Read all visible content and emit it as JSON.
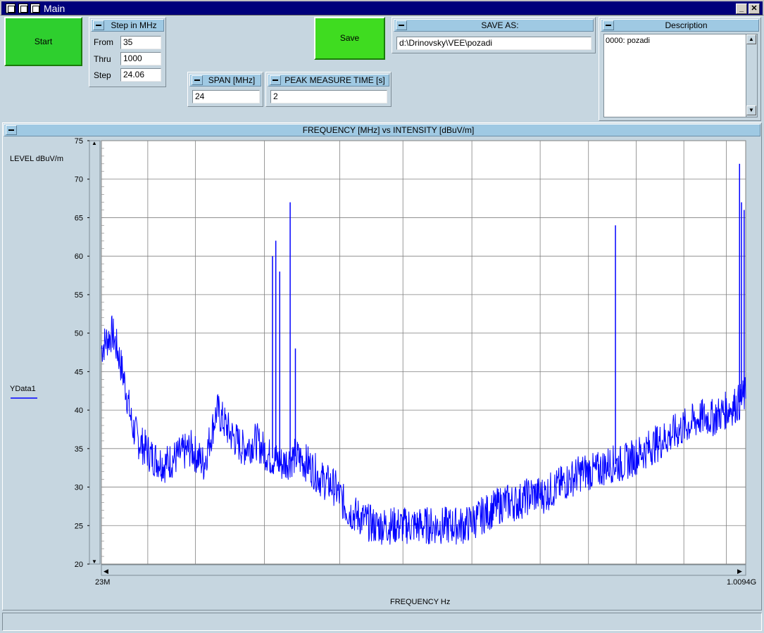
{
  "window": {
    "title": "Main"
  },
  "buttons": {
    "start": "Start",
    "save": "Save"
  },
  "step_panel": {
    "title": "Step in MHz",
    "from_label": "From",
    "from_value": "35",
    "thru_label": "Thru",
    "thru_value": "1000",
    "step_label": "Step",
    "step_value": "24.06"
  },
  "span_panel": {
    "title": "SPAN [MHz]",
    "value": "24"
  },
  "peak_panel": {
    "title": "PEAK MEASURE TIME [s]",
    "value": "2"
  },
  "save_panel": {
    "title": "SAVE AS:",
    "value": "d:\\Drinovsky\\VEE\\pozadi"
  },
  "description_panel": {
    "title": "Description",
    "value": "0000: pozadi"
  },
  "chart_panel": {
    "title": "FREQUENCY [MHz] vs INTENSITY [dBuV/m]"
  },
  "colors": {
    "trace": "#0000ff",
    "start_button": "#2ecf2e",
    "save_button": "#3fdc20",
    "panel_header": "#9fc9e3"
  },
  "chart_data": {
    "type": "line",
    "title": "FREQUENCY [MHz] vs INTENSITY [dBuV/m]",
    "xlabel": "FREQUENCY Hz",
    "ylabel": "LEVEL dBuV/m",
    "x_start_label": "23M",
    "x_end_label": "1.0094G",
    "xlim_mhz": [
      23,
      1009.4
    ],
    "ylim": [
      20,
      75
    ],
    "yticks": [
      20,
      25,
      30,
      35,
      40,
      45,
      50,
      55,
      60,
      65,
      70,
      75
    ],
    "grid": true,
    "legend": {
      "position": "left",
      "entries": [
        "YData1"
      ]
    },
    "series": [
      {
        "name": "YData1",
        "x_mhz": [
          23,
          30,
          40,
          50,
          60,
          70,
          80,
          90,
          100,
          120,
          140,
          160,
          170,
          180,
          200,
          220,
          240,
          260,
          280,
          300,
          320,
          340,
          360,
          380,
          400,
          420,
          440,
          460,
          480,
          500,
          520,
          540,
          560,
          580,
          600,
          620,
          640,
          660,
          680,
          700,
          720,
          740,
          760,
          780,
          800,
          820,
          840,
          860,
          880,
          900,
          920,
          940,
          960,
          980,
          1000,
          1009.4
        ],
        "level_dbuv_m": [
          48,
          49,
          50,
          47,
          43,
          38,
          36,
          35,
          34,
          33,
          34,
          35,
          34,
          33,
          40,
          37,
          35,
          36,
          34,
          33,
          34,
          33,
          31,
          30,
          27,
          26,
          25,
          25,
          25,
          25,
          25,
          25,
          25,
          25,
          26,
          27,
          28,
          28,
          29,
          29,
          30,
          31,
          32,
          32,
          33,
          33,
          34,
          35,
          36,
          37,
          38,
          39,
          39,
          40,
          41,
          42
        ]
      }
    ],
    "peaks": [
      {
        "x_mhz": 285,
        "level_dbuv_m": 60
      },
      {
        "x_mhz": 290,
        "level_dbuv_m": 62
      },
      {
        "x_mhz": 296,
        "level_dbuv_m": 58
      },
      {
        "x_mhz": 312,
        "level_dbuv_m": 67
      },
      {
        "x_mhz": 320,
        "level_dbuv_m": 48
      },
      {
        "x_mhz": 810,
        "level_dbuv_m": 64
      },
      {
        "x_mhz": 1000,
        "level_dbuv_m": 72
      },
      {
        "x_mhz": 1003,
        "level_dbuv_m": 67
      },
      {
        "x_mhz": 1007,
        "level_dbuv_m": 66
      }
    ]
  }
}
